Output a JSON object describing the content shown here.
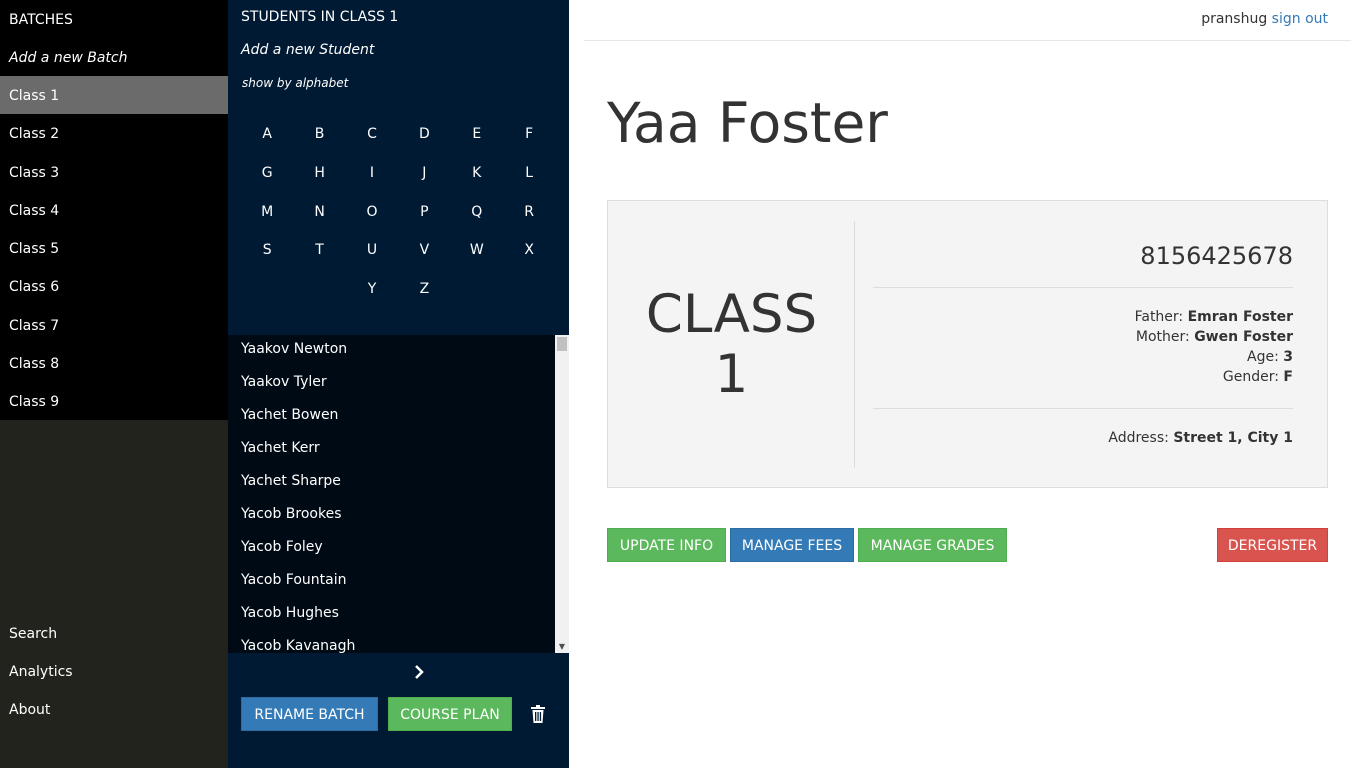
{
  "sidebar": {
    "header": "BATCHES",
    "add_batch": "Add a new Batch",
    "classes": [
      "Class 1",
      "Class 2",
      "Class 3",
      "Class 4",
      "Class 5",
      "Class 6",
      "Class 7",
      "Class 8",
      "Class 9"
    ],
    "active_index": 0,
    "bottom": [
      "Search",
      "Analytics",
      "About"
    ]
  },
  "students_panel": {
    "title": "STUDENTS IN CLASS 1",
    "add_student": "Add a new Student",
    "show_by": "show by alphabet",
    "letters": [
      "A",
      "B",
      "C",
      "D",
      "E",
      "F",
      "G",
      "H",
      "I",
      "J",
      "K",
      "L",
      "M",
      "N",
      "O",
      "P",
      "Q",
      "R",
      "S",
      "T",
      "U",
      "V",
      "W",
      "X",
      "",
      "",
      "Y",
      "Z",
      "",
      ""
    ],
    "students": [
      "Yaakov Newton",
      "Yaakov Tyler",
      "Yachet Bowen",
      "Yachet Kerr",
      "Yachet Sharpe",
      "Yacob Brookes",
      "Yacob Foley",
      "Yacob Fountain",
      "Yacob Hughes",
      "Yacob Kavanagh"
    ],
    "rename_label": "RENAME BATCH",
    "course_plan_label": "COURSE PLAN"
  },
  "header": {
    "username": "pranshug",
    "signout": "sign out"
  },
  "student": {
    "name": "Yaa Foster",
    "class_word": "CLASS",
    "class_number": "1",
    "phone": "8156425678",
    "father_label": "Father:",
    "father": "Emran Foster",
    "mother_label": "Mother:",
    "mother": "Gwen Foster",
    "age_label": "Age:",
    "age": "3",
    "gender_label": "Gender:",
    "gender": "F",
    "address_label": "Address:",
    "address": "Street 1, City 1"
  },
  "actions": {
    "update": "UPDATE INFO",
    "fees": "MANAGE FEES",
    "grades": "MANAGE GRADES",
    "deregister": "DEREGISTER"
  },
  "colors": {
    "primary": "#337ab7",
    "success": "#5cb85c",
    "danger": "#d9534f",
    "panel_dark": "#001a33"
  },
  "icons": {
    "next": "chevron-right-icon",
    "delete": "trash-icon"
  }
}
